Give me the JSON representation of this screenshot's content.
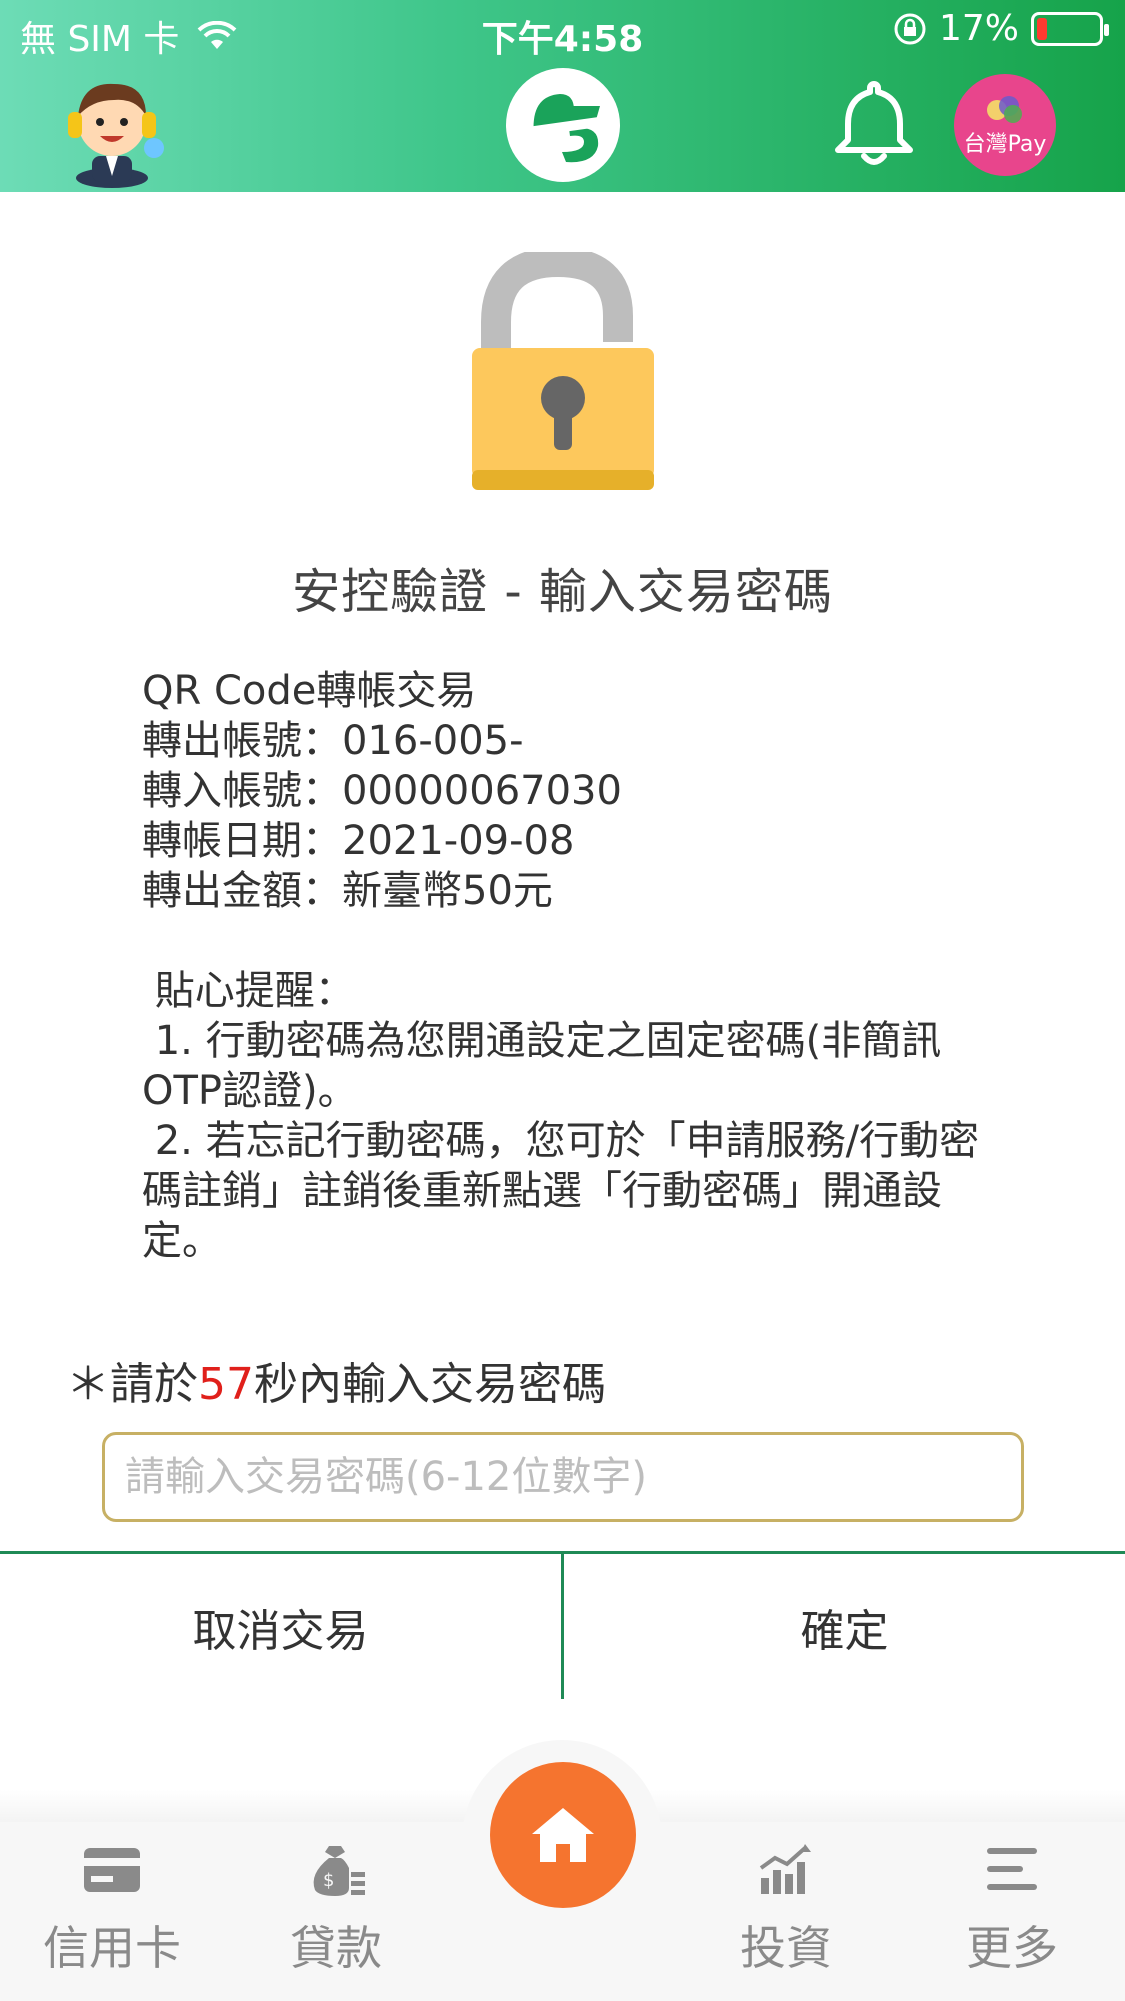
{
  "status_bar": {
    "carrier": "無 SIM 卡",
    "time": "下午4:58",
    "battery_percent": "17%",
    "battery_level": 0.17
  },
  "header": {
    "pay_badge_text": "台灣Pay"
  },
  "title": "安控驗證 - 輸入交易密碼",
  "transaction": {
    "line1": "QR Code轉帳交易",
    "line2": "轉出帳號：016-005-",
    "line3": "轉入帳號：00000067030",
    "line4": "轉帳日期：2021-09-08",
    "line5": "轉出金額：新臺幣50元"
  },
  "reminder": {
    "heading": "貼心提醒：",
    "item1": "1. 行動密碼為您開通設定之固定密碼(非簡訊OTP認證)。",
    "item2": "2. 若忘記行動密碼，您可於「申請服務/行動密碼註銷」註銷後重新點選「行動密碼」開通設定。"
  },
  "countdown": {
    "prefix": "＊請於",
    "seconds": "57",
    "suffix": "秒內輸入交易密碼"
  },
  "password_input": {
    "placeholder": "請輸入交易密碼(6-12位數字)",
    "value": ""
  },
  "actions": {
    "cancel_label": "取消交易",
    "confirm_label": "確定"
  },
  "bottom_nav": {
    "credit_card": "信用卡",
    "loan": "貸款",
    "invest": "投資",
    "more": "更多"
  },
  "colors": {
    "accent_green": "#1f8a56",
    "home_orange": "#f5742f",
    "countdown_red": "#e0201b",
    "input_border": "#c7b064"
  },
  "icons": {
    "avatar": "customer-service-avatar-icon",
    "logo": "bank-logo-icon",
    "bell": "bell-icon",
    "lock": "unlocked-padlock-icon",
    "home": "home-icon"
  }
}
